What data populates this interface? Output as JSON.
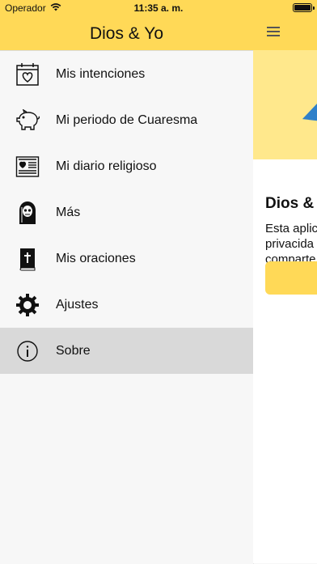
{
  "status_bar": {
    "carrier": "Operador",
    "time": "11:35 a. m.",
    "battery_level_percent": 100
  },
  "header": {
    "title": "Dios & Yo",
    "menu_icon": "hamburger-icon"
  },
  "colors": {
    "accent": "#ffd957",
    "hero": "#ffe88c",
    "selected_row": "#d9d9d9",
    "drawer_bg": "#f7f7f7"
  },
  "menu": {
    "items": [
      {
        "label": "Mis intenciones",
        "icon": "calendar-heart-icon"
      },
      {
        "label": "Mi periodo de Cuaresma",
        "icon": "piggy-bank-icon"
      },
      {
        "label": "Mi diario religioso",
        "icon": "journal-icon"
      },
      {
        "label": "Más",
        "icon": "grim-reaper-icon"
      },
      {
        "label": "Mis oraciones",
        "icon": "bible-icon"
      },
      {
        "label": "Ajustes",
        "icon": "gear-icon"
      },
      {
        "label": "Sobre",
        "icon": "info-icon"
      }
    ],
    "selected": "Sobre"
  },
  "content": {
    "title": "Dios &",
    "text_lines": [
      "Esta aplic",
      "privacida",
      "comparte"
    ]
  }
}
